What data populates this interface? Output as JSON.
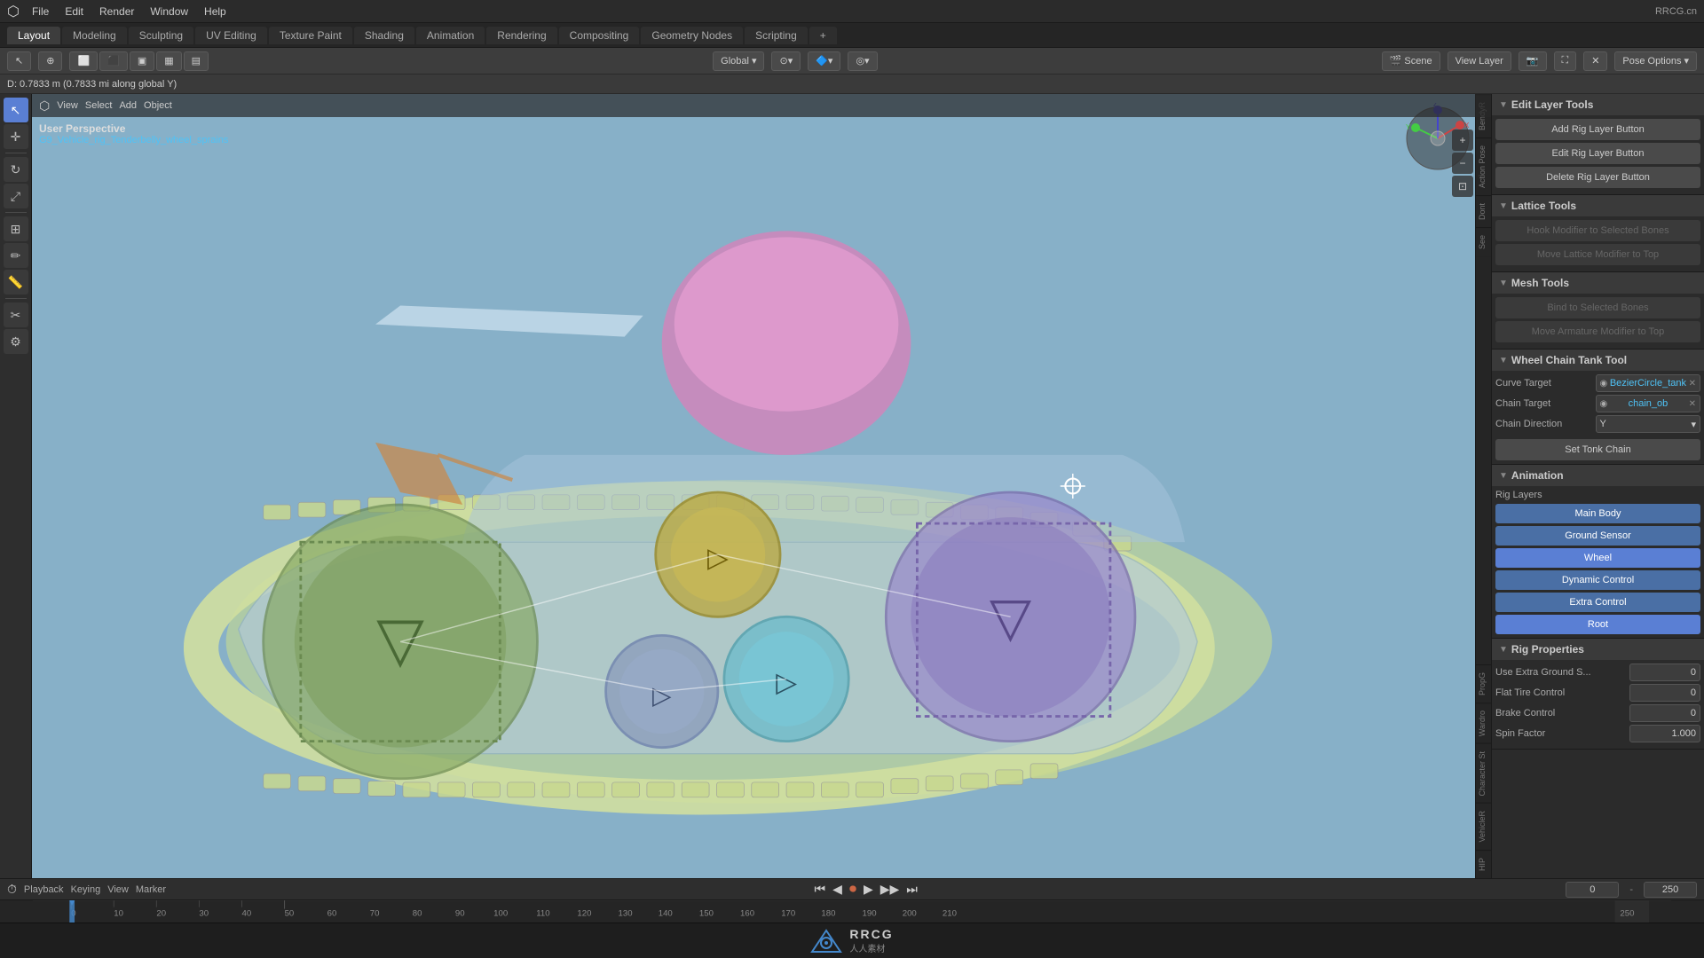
{
  "app": {
    "title": "RRCG.cn",
    "top_right": "RRCG.cn"
  },
  "menus": {
    "items": [
      "File",
      "Edit",
      "Render",
      "Window",
      "Help"
    ]
  },
  "workspace_tabs": {
    "tabs": [
      "Layout",
      "Modeling",
      "Sculpting",
      "UV Editing",
      "Texture Paint",
      "Shading",
      "Animation",
      "Rendering",
      "Compositing",
      "Geometry Nodes",
      "Scripting"
    ],
    "active": "Layout",
    "add_btn": "+"
  },
  "header_bar": {
    "mode": "Pose Options",
    "global_dropdown": "Global",
    "view_layer": "View Layer",
    "scene": "Scene"
  },
  "info_bar": {
    "text": "D: 0.7833 m (0.7833 mi along global Y)"
  },
  "viewport": {
    "perspective": "User Perspective",
    "object_name": "G9_Vehicle_rig_Tenderbelly_wheel_sprains"
  },
  "right_panel": {
    "edit_layer_tools": {
      "title": "Edit Layer Tools",
      "buttons": [
        "Add Rig Layer Button",
        "Edit Rig Layer Button",
        "Delete Rig Layer Button"
      ]
    },
    "lattice_tools": {
      "title": "Lattice Tools",
      "buttons": [
        "Hook Modifier to Selected Bones",
        "Move Lattice Modifier to Top"
      ]
    },
    "mesh_tools": {
      "title": "Mesh Tools",
      "buttons": [
        "Bind to Selected Bones",
        "Move Armature Modifier to Top"
      ]
    },
    "wheel_chain_tank_tool": {
      "title": "Wheel Chain Tank Tool",
      "curve_target_label": "Curve Target",
      "curve_target_value": "BezierCircle_tank",
      "chain_target_label": "Chain Target",
      "chain_target_value": "chain_ob",
      "chain_direction_label": "Chain Direction",
      "chain_direction_value": "Y",
      "set_tonk_chain_label": "Set Tonk Chain"
    },
    "animation": {
      "title": "Animation",
      "rig_layers_title": "Rig Layers",
      "layers": [
        {
          "label": "Main Body",
          "class": "rig-layer-main"
        },
        {
          "label": "Ground Sensor",
          "class": "rig-layer-ground"
        },
        {
          "label": "Wheel",
          "class": "rig-layer-wheel"
        },
        {
          "label": "Dynamic Control",
          "class": "rig-layer-dynamic"
        },
        {
          "label": "Extra Control",
          "class": "rig-layer-extra"
        },
        {
          "label": "Root",
          "class": "rig-layer-root"
        }
      ]
    },
    "rig_properties": {
      "title": "Rig Properties",
      "properties": [
        {
          "label": "Use Extra Ground S...",
          "value": "0"
        },
        {
          "label": "Flat Tire Control",
          "value": "0"
        },
        {
          "label": "Brake Control",
          "value": "0"
        },
        {
          "label": "Spin Factor",
          "value": "1.000"
        }
      ]
    }
  },
  "side_tabs_left": [
    "BendyR",
    "Action Pose",
    "Dont",
    "See"
  ],
  "side_tabs_right": [
    "PropG",
    "Wardro",
    "Character St",
    "VehicleR",
    "HIP"
  ],
  "timeline": {
    "playback": "Playback",
    "keying": "Keying",
    "view": "View",
    "marker": "Marker",
    "current_frame": "0",
    "end_frame": "250",
    "markers": [
      0,
      50,
      100,
      150,
      200,
      210
    ],
    "ruler_marks": [
      0,
      10,
      20,
      30,
      40,
      50,
      60,
      70,
      80,
      90,
      100,
      110,
      120,
      130,
      140,
      150,
      160,
      170,
      180,
      190,
      200,
      210
    ]
  },
  "logo": {
    "brand": "RRCG",
    "sub": "人人素材"
  }
}
